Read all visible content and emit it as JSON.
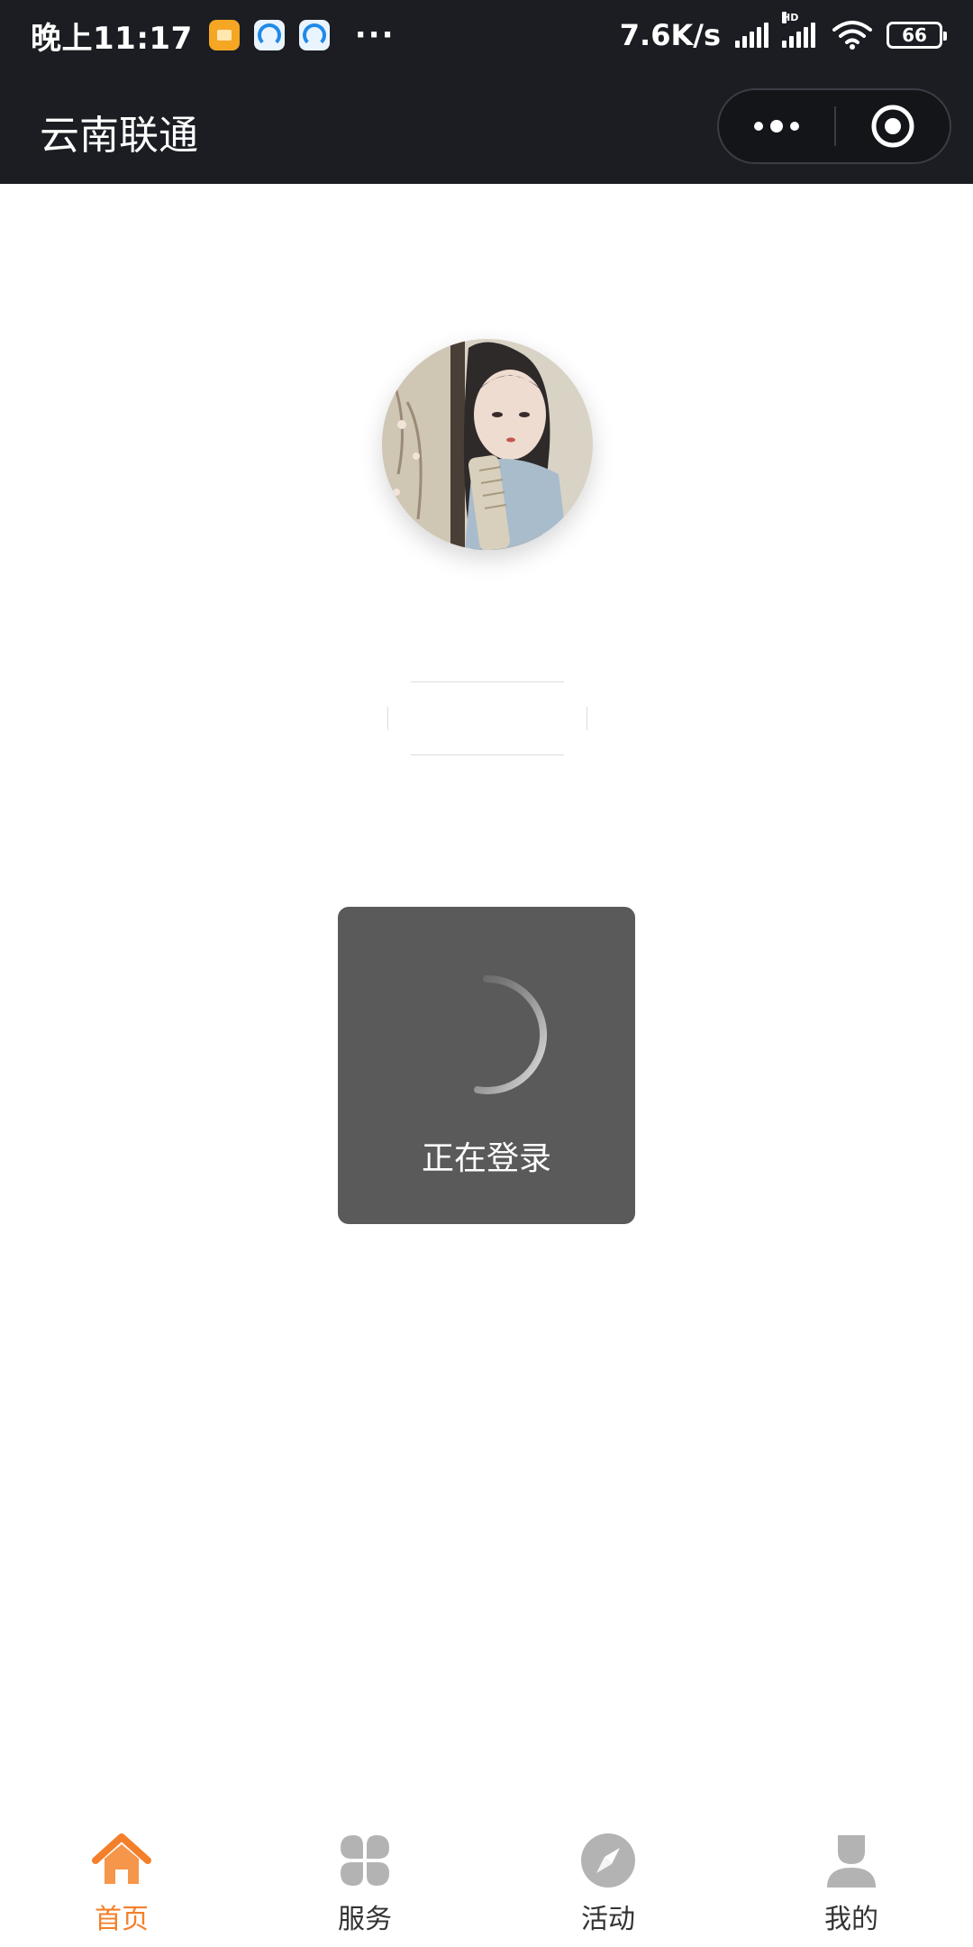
{
  "status_bar": {
    "time": "晚上11:17",
    "more": "···",
    "net_speed": "7.6K/s",
    "hd": "HD",
    "battery": "66",
    "notification_icons": [
      "message-icon",
      "browser-app-icon",
      "browser-app-icon"
    ]
  },
  "header": {
    "title": "云南联通",
    "menu_icon": "more-dots-icon",
    "close_icon": "target-circle-icon",
    "background": "#1b1d22"
  },
  "profile": {
    "avatar": "avatar-illustration"
  },
  "toast": {
    "message": "正在登录",
    "icon": "loading-spinner-icon"
  },
  "tabbar": {
    "active_color": "#f47f2a",
    "inactive_color": "#b3b3b3",
    "items": [
      {
        "label": "首页",
        "icon": "home-icon",
        "active": true
      },
      {
        "label": "服务",
        "icon": "grid-services-icon",
        "active": false
      },
      {
        "label": "活动",
        "icon": "compass-icon",
        "active": false
      },
      {
        "label": "我的",
        "icon": "user-icon",
        "active": false
      }
    ]
  }
}
